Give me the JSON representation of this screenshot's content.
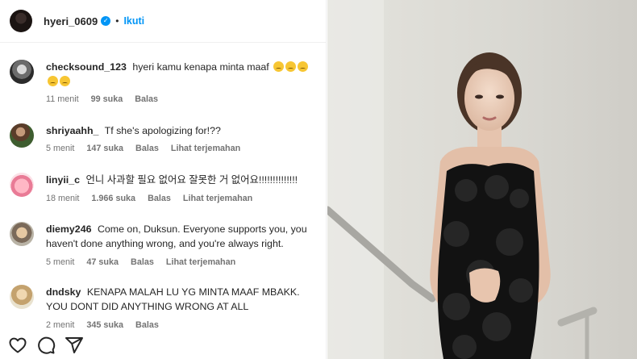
{
  "header": {
    "username": "hyeri_0609",
    "separator": "•",
    "follow_label": "Ikuti",
    "verified_glyph": "✓"
  },
  "comments": [
    {
      "username": "checksound_123",
      "text": "hyeri kamu kenapa minta maaf",
      "emoji_count": 5,
      "time": "11 menit",
      "likes": "99 suka",
      "reply": "Balas",
      "translate": ""
    },
    {
      "username": "shriyaahh_",
      "text": "Tf she's apologizing for!??",
      "time": "5 menit",
      "likes": "147 suka",
      "reply": "Balas",
      "translate": "Lihat terjemahan"
    },
    {
      "username": "linyii_c",
      "text": "언니 사과할 필요 없어요 잘못한 거 없어요!!!!!!!!!!!!!!",
      "time": "18 menit",
      "likes": "1.966 suka",
      "reply": "Balas",
      "translate": "Lihat terjemahan"
    },
    {
      "username": "diemy246",
      "text": "Come on, Duksun. Everyone supports you, you haven't done anything wrong, and you're always right.",
      "time": "5 menit",
      "likes": "47 suka",
      "reply": "Balas",
      "translate": "Lihat terjemahan"
    },
    {
      "username": "dndsky",
      "text": "KENAPA MALAH LU YG MINTA MAAF MBAKK. YOU DONT DID ANYTHING WRONG AT ALL",
      "time": "2 menit",
      "likes": "345 suka",
      "reply": "Balas",
      "translate": ""
    }
  ],
  "actions": {
    "icons": [
      "heart-icon",
      "comment-icon",
      "share-icon"
    ]
  },
  "colors": {
    "accent": "#0095f6",
    "meta_text": "#737373",
    "text": "#262626"
  }
}
